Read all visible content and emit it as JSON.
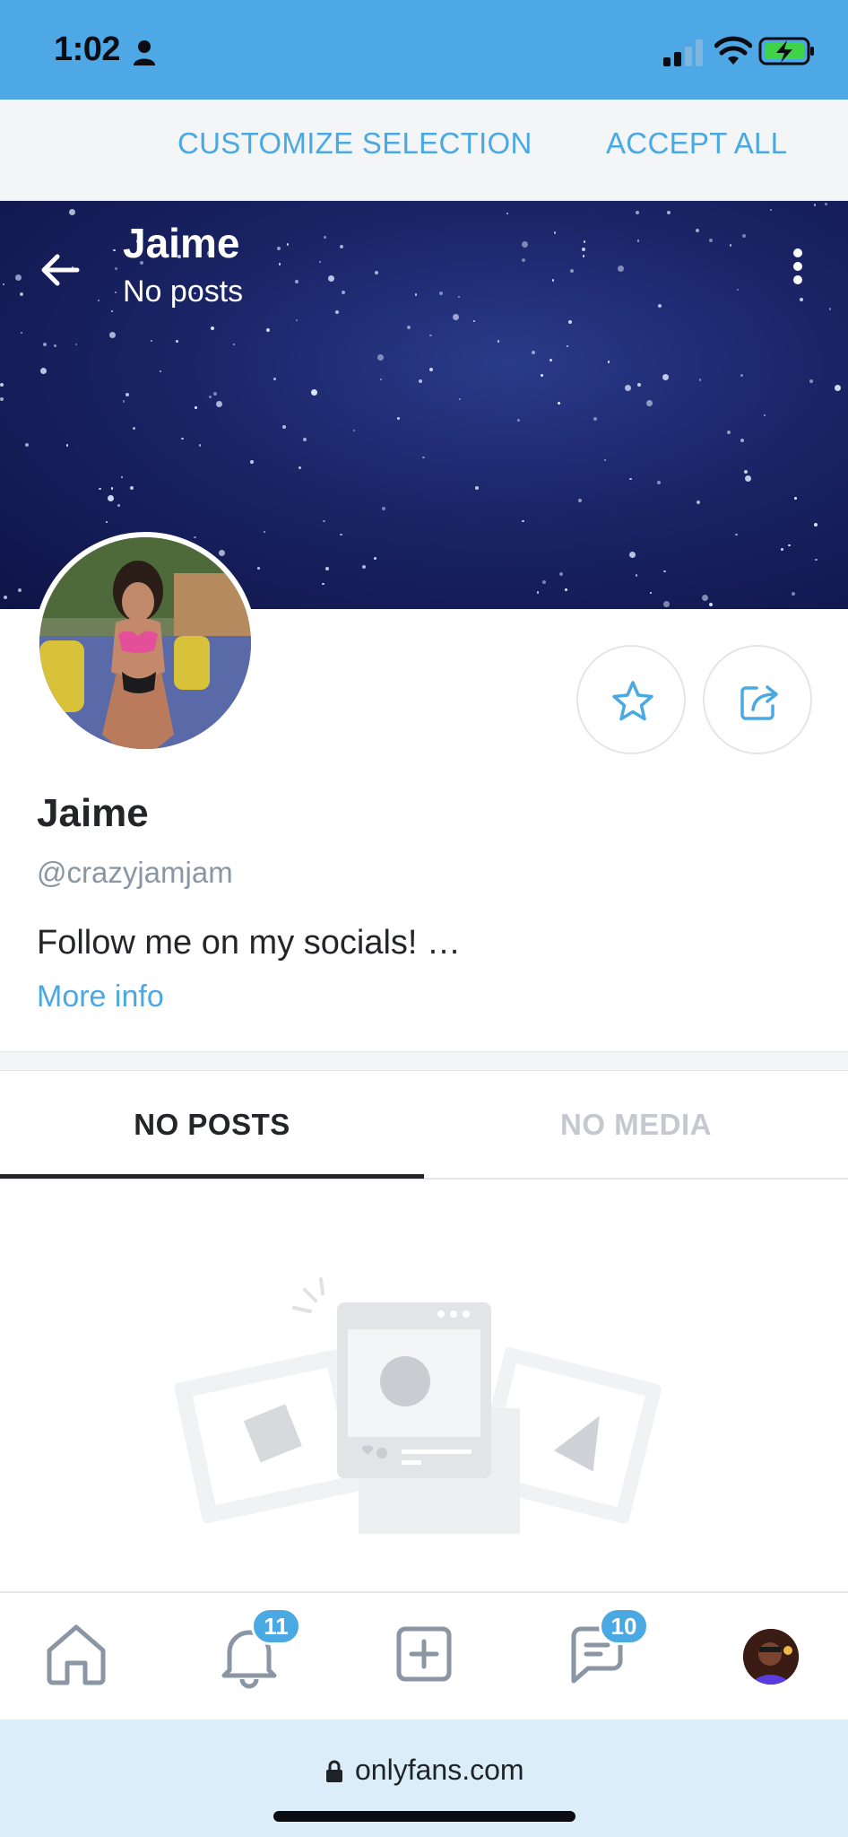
{
  "status_bar": {
    "time": "1:02",
    "icons": [
      "person-icon",
      "cellular-signal-icon",
      "wifi-icon",
      "battery-charging-icon"
    ],
    "background_color": "#4ea8e6"
  },
  "cookie_bar": {
    "customize_label": "CUSTOMIZE SELECTION",
    "accept_label": "ACCEPT ALL"
  },
  "header": {
    "name": "Jaime",
    "subtitle": "No posts"
  },
  "profile": {
    "name": "Jaime",
    "handle": "@crazyjamjam",
    "bio": "Follow me on my socials! …",
    "more_info_label": "More info"
  },
  "tabs": [
    {
      "label": "NO POSTS",
      "active": true
    },
    {
      "label": "NO MEDIA",
      "active": false
    }
  ],
  "bottom_nav": {
    "items": [
      "home-icon",
      "bell-icon",
      "add-post-icon",
      "chat-icon",
      "avatar"
    ],
    "notifications_badge": "11",
    "messages_badge": "10"
  },
  "url_bar": {
    "url": "onlyfans.com"
  },
  "colors": {
    "accent": "#4aa8e2",
    "text": "#242529",
    "muted": "#8a96a3"
  }
}
